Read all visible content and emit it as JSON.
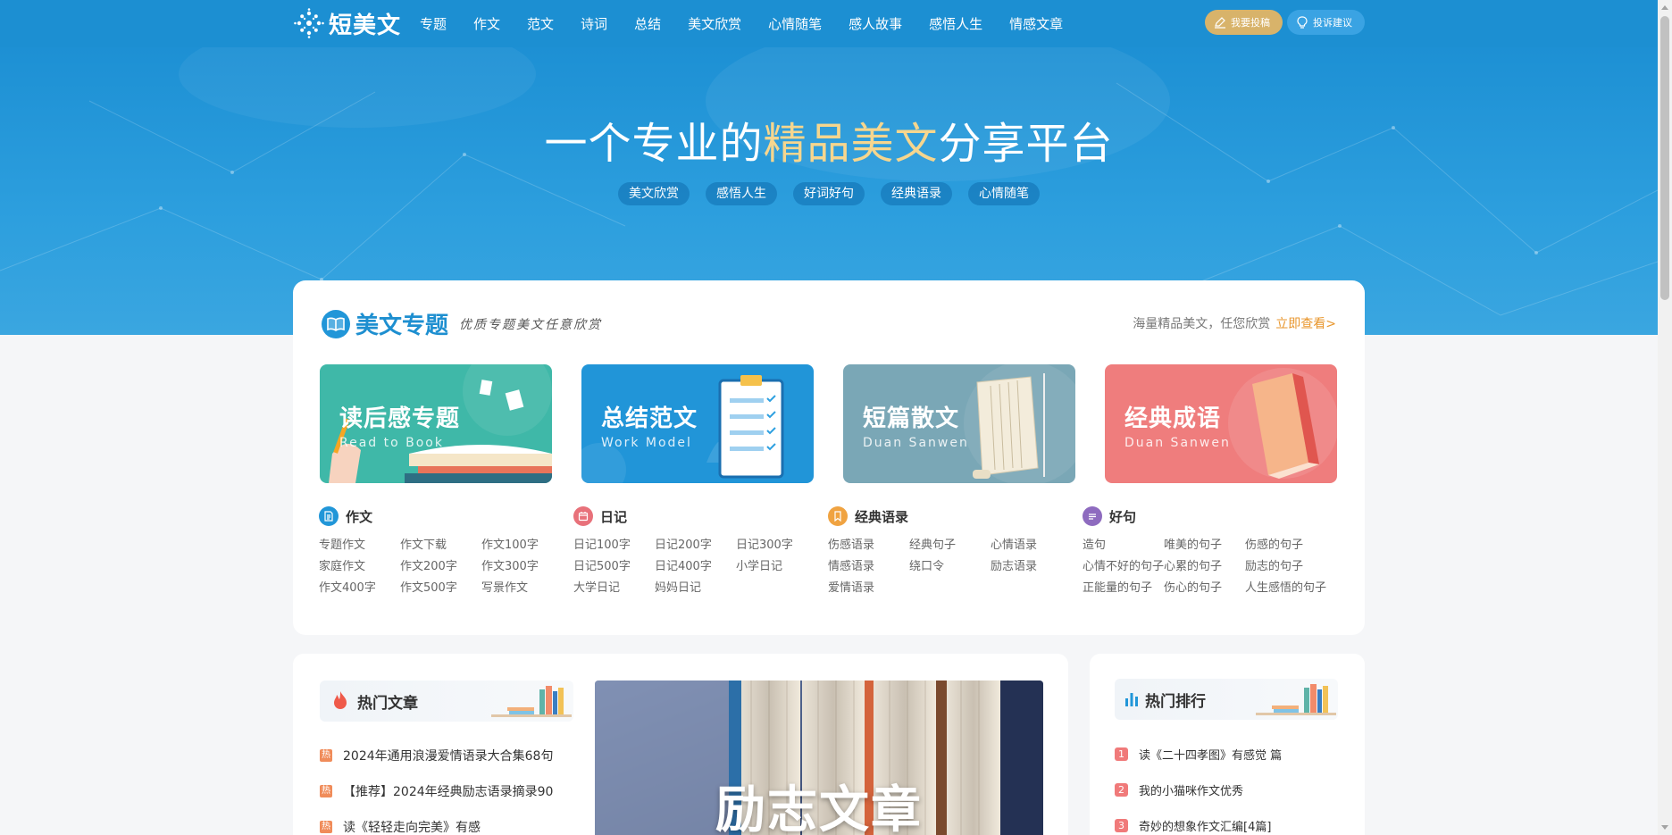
{
  "brand": {
    "name": "短美文",
    "logo_icon": "flower-logo-icon"
  },
  "nav": {
    "links": [
      "专题",
      "作文",
      "范文",
      "诗词",
      "总结",
      "美文欣赏",
      "心情随笔",
      "感人故事",
      "感悟人生",
      "情感文章"
    ],
    "submit_label": "我要投稿",
    "advice_label": "投诉建议"
  },
  "hero": {
    "title_pre": "一个专业的",
    "title_hl": "精品美文",
    "title_post": "分享平台",
    "tags": [
      "美文欣赏",
      "感悟人生",
      "好词好句",
      "经典语录",
      "心情随笔"
    ]
  },
  "topics": {
    "title": "美文专题",
    "subtitle": "优质专题美文任意欣赏",
    "more_text": "海量精品美文，任您欣赏",
    "more_link": "立即查看>",
    "banners": [
      {
        "title": "读后感专题",
        "sub": "Read to Book"
      },
      {
        "title": "总结范文",
        "sub": "Work Model"
      },
      {
        "title": "短篇散文",
        "sub": "Duan Sanwen"
      },
      {
        "title": "经典成语",
        "sub": "Duan Sanwen"
      }
    ],
    "categories": [
      {
        "name": "作文",
        "items": [
          "专题作文",
          "作文下载",
          "作文100字",
          "家庭作文",
          "作文200字",
          "作文300字",
          "作文400字",
          "作文500字",
          "写景作文"
        ]
      },
      {
        "name": "日记",
        "items": [
          "日记100字",
          "日记200字",
          "日记300字",
          "日记500字",
          "日记400字",
          "小学日记",
          "大学日记",
          "妈妈日记"
        ]
      },
      {
        "name": "经典语录",
        "items": [
          "伤感语录",
          "经典句子",
          "心情语录",
          "情感语录",
          "绕口令",
          "励志语录",
          "爱情语录"
        ]
      },
      {
        "name": "好句",
        "items": [
          "造句",
          "唯美的句子",
          "伤感的句子",
          "心情不好的句子",
          "心累的句子",
          "励志的句子",
          "正能量的句子",
          "伤心的句子",
          "人生感悟的句子"
        ]
      }
    ],
    "colors": {
      "cat1": "#2196d8",
      "cat2": "#e8717a",
      "cat3": "#f0a341",
      "cat4": "#8e6bbf"
    }
  },
  "hot": {
    "title": "热门文章",
    "badge": "热",
    "items": [
      "2024年通用浪漫爱情语录大合集68句",
      "【推荐】2024年经典励志语录摘录90",
      "读《轻轻走向完美》有感"
    ]
  },
  "feature": {
    "title": "励志文章"
  },
  "rank": {
    "title": "热门排行",
    "items": [
      {
        "num": "1",
        "text": "读《二十四孝图》有感觉 篇"
      },
      {
        "num": "2",
        "text": "我的小猫咪作文优秀"
      },
      {
        "num": "3",
        "text": "奇妙的想象作文汇编[4篇]"
      }
    ]
  }
}
